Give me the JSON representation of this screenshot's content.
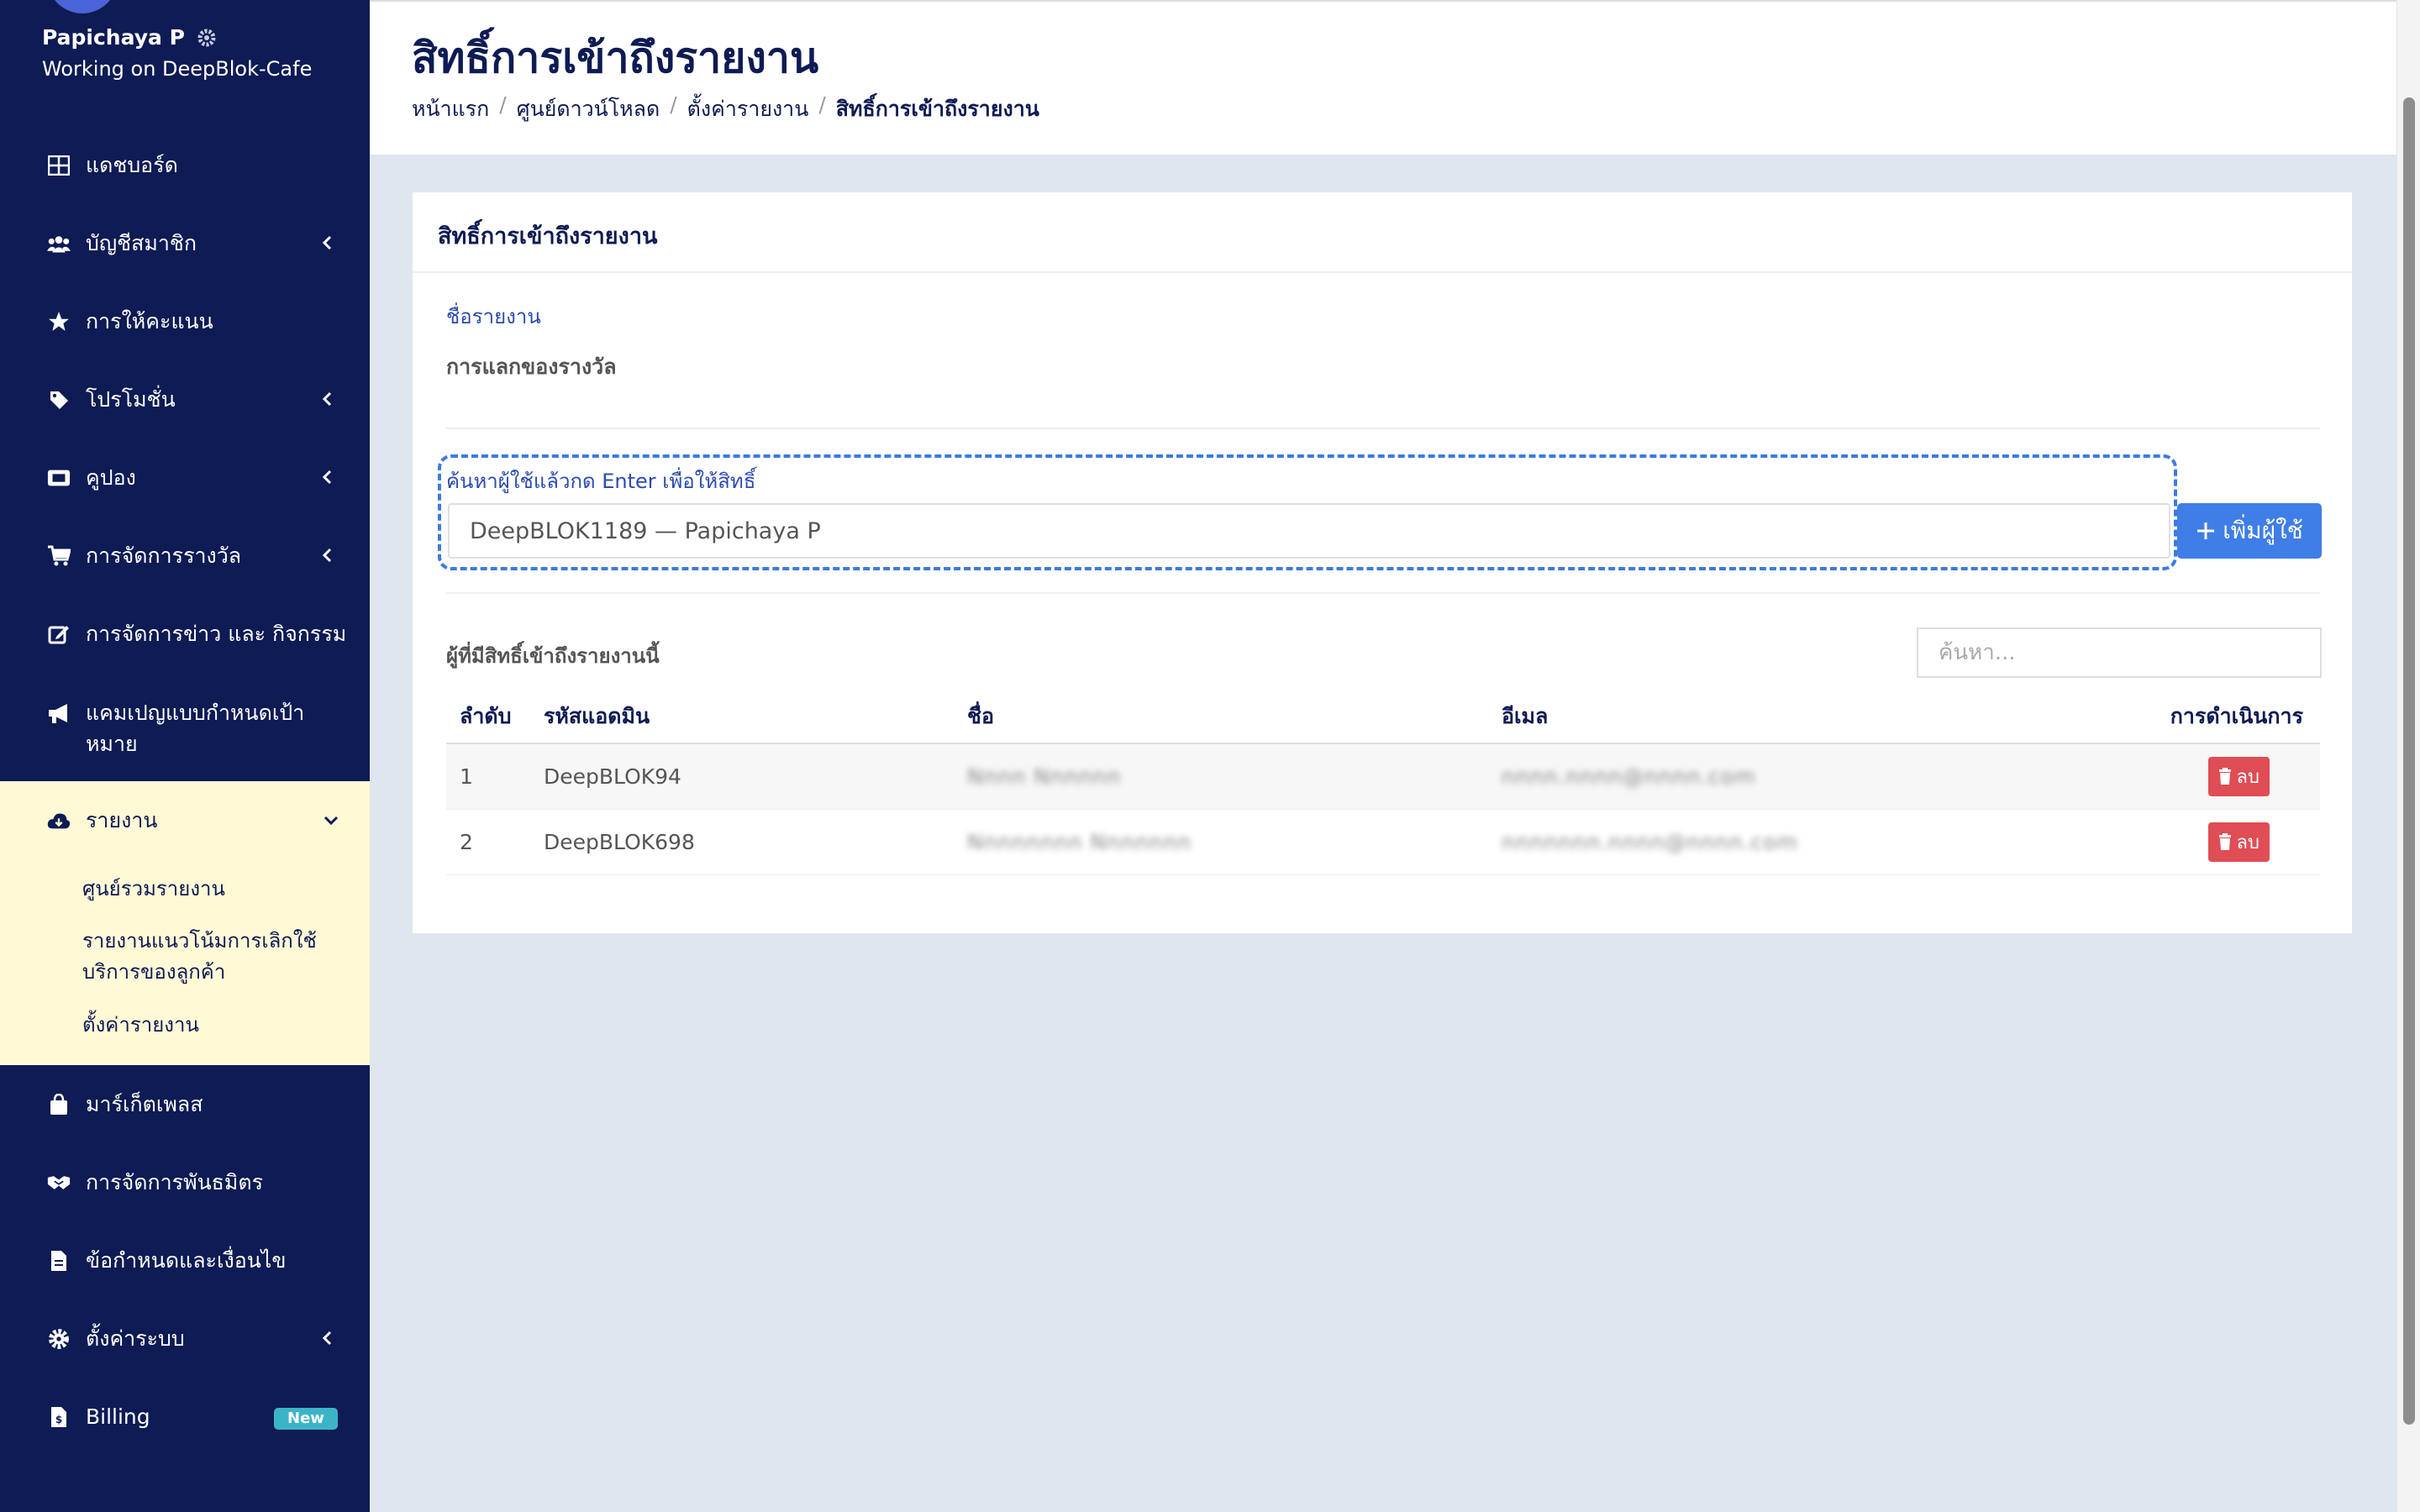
{
  "user": {
    "name": "Papichaya P",
    "subtitle": "Working on DeepBlok-Cafe"
  },
  "sidebar": {
    "items": [
      {
        "label": "แดชบอร์ด",
        "icon": "dashboard-icon"
      },
      {
        "label": "บัญชีสมาชิก",
        "icon": "users-icon"
      },
      {
        "label": "การให้คะแนน",
        "icon": "star-icon"
      },
      {
        "label": "โปรโมชั่น",
        "icon": "tag-icon"
      },
      {
        "label": "คูปอง",
        "icon": "ticket-icon"
      },
      {
        "label": "การจัดการรางวัล",
        "icon": "cart-icon"
      },
      {
        "label": "การจัดการข่าว และ กิจกรรม",
        "icon": "edit-icon"
      },
      {
        "label": "แคมเปญแบบกำหนดเป้าหมาย",
        "icon": "megaphone-icon"
      },
      {
        "label": "รายงาน",
        "icon": "cloud-download-icon"
      },
      {
        "label": "มาร์เก็ตเพลส",
        "icon": "bag-icon"
      },
      {
        "label": "การจัดการพันธมิตร",
        "icon": "handshake-icon"
      },
      {
        "label": "ข้อกำหนดและเงื่อนไข",
        "icon": "file-icon"
      },
      {
        "label": "ตั้งค่าระบบ",
        "icon": "gear-icon"
      },
      {
        "label": "Billing",
        "icon": "invoice-icon",
        "badge": "New"
      }
    ],
    "report_subitems": [
      "ศูนย์รวมรายงาน",
      "รายงานแนวโน้มการเลิกใช้บริการของลูกค้า",
      "ตั้งค่ารายงาน"
    ]
  },
  "header": {
    "title": "สิทธิ์การเข้าถึงรายงาน",
    "breadcrumb": [
      "หน้าแรก",
      "ศูนย์ดาวน์โหลด",
      "ตั้งค่ารายงาน",
      "สิทธิ์การเข้าถึงรายงาน"
    ]
  },
  "card": {
    "title": "สิทธิ์การเข้าถึงรายงาน",
    "report_name_label": "ชื่อรายงาน",
    "report_name_value": "การแลกของรางวัล",
    "search_user_label": "ค้นหาผู้ใช้แล้วกด Enter เพื่อให้สิทธิ์",
    "search_user_value": "DeepBLOK1189 — Papichaya P",
    "add_user_label": "เพิ่มผู้ใช้",
    "table_caption": "ผู้ที่มีสิทธิ์เข้าถึงรายงานนี้",
    "table_search_placeholder": "ค้นหา...",
    "columns": [
      "ลำดับ",
      "รหัสแอดมิน",
      "ชื่อ",
      "อีเมล",
      "การดำเนินการ"
    ],
    "rows": [
      {
        "no": "1",
        "admin_id": "DeepBLOK94",
        "name": "Nnnn Nnnnnn",
        "email": "nnnn.nnnn@nnnn.com",
        "action": "ลบ"
      },
      {
        "no": "2",
        "admin_id": "DeepBLOK698",
        "name": "Nnnnnnnn Nnnnnnn",
        "email": "nnnnnnn.nnnn@nnnn.com",
        "action": "ลบ"
      }
    ]
  },
  "colors": {
    "sidebar_bg": "#0e1b54",
    "accent": "#3f7ee6",
    "danger": "#df4d55",
    "active_panel": "#fff9d6"
  }
}
